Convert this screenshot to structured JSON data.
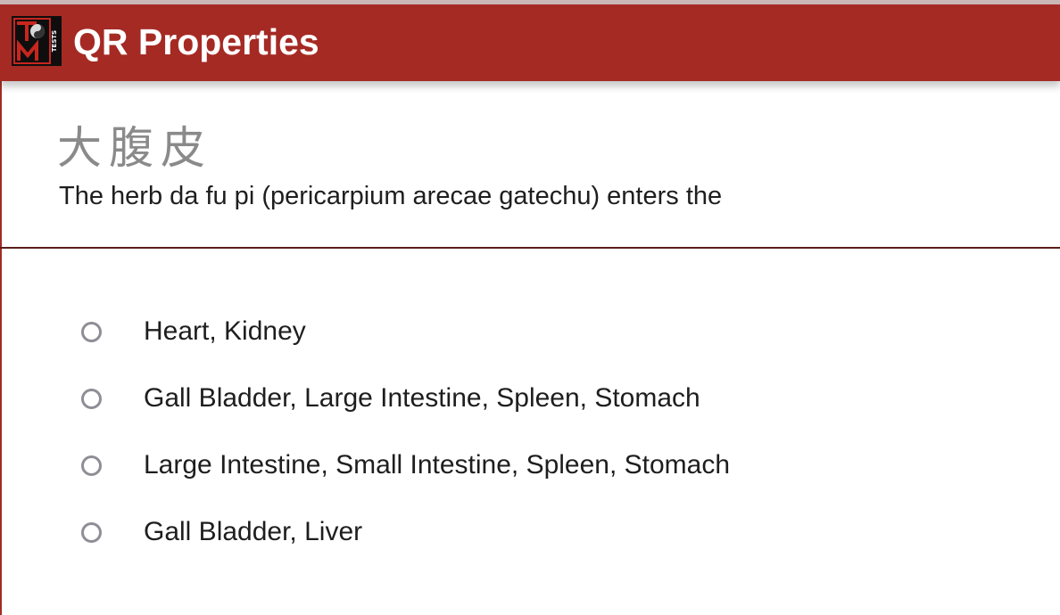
{
  "header": {
    "title": "QR Properties",
    "logo_icon": "tcm-tests-logo-icon",
    "logo_text": "TESTS",
    "background_color": "#a52a24"
  },
  "question": {
    "chinese_name": "大腹皮",
    "prompt": "The herb da fu pi (pericarpium arecae gatechu) enters the"
  },
  "options": [
    {
      "label": "Heart, Kidney",
      "selected": false
    },
    {
      "label": "Gall Bladder, Large Intestine, Spleen, Stomach",
      "selected": false
    },
    {
      "label": "Large Intestine, Small Intestine, Spleen, Stomach",
      "selected": false
    },
    {
      "label": "Gall Bladder, Liver",
      "selected": false
    }
  ]
}
